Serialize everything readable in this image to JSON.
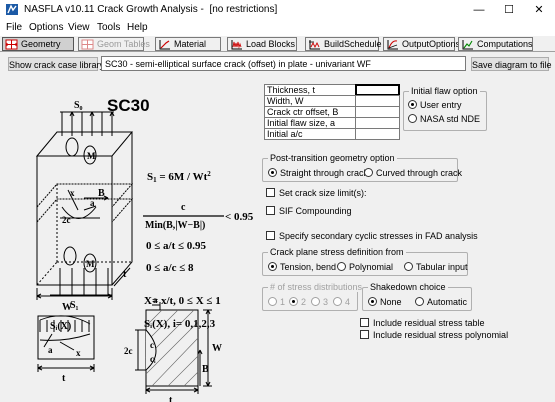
{
  "window": {
    "title": "NASFLA v10.11 Crack Growth Analysis -  [no restrictions]",
    "minimize": "—",
    "maximize": "☐",
    "close": "✕"
  },
  "menu": [
    "File",
    "Options",
    "View",
    "Tools",
    "Help"
  ],
  "tabs": [
    {
      "label": "Geometry",
      "icon": "geometry-icon",
      "state": "active"
    },
    {
      "label": "Geom Tables",
      "icon": "geometry-tables-icon",
      "state": "disabled"
    },
    {
      "label": "Material",
      "icon": "material-chart-icon",
      "state": "normal"
    },
    {
      "label": "Load Blocks",
      "icon": "load-blocks-icon",
      "state": "normal"
    },
    {
      "label": "BuildSchedule",
      "icon": "build-schedule-icon",
      "state": "normal"
    },
    {
      "label": "OutputOptions",
      "icon": "output-options-icon",
      "state": "normal"
    },
    {
      "label": "Computations",
      "icon": "computations-icon",
      "state": "normal"
    }
  ],
  "toolbar": {
    "library_button": "Show crack case library",
    "case_description": "SC30  - semi-elliptical surface crack (offset) in plate - univariant WF",
    "save_button": "Save diagram to file"
  },
  "diagram": {
    "case_code": "SC30",
    "s1_eq": "S",
    "s1_sub": "1",
    "s1_rhs": " = 6M / Wt",
    "s1_sup": "2",
    "frac_num": "c",
    "frac_den": "Min(B,|W−B|)",
    "frac_rhs": "< 0.95",
    "cond1": "0 ≤  a/t  ≤ 0.95",
    "cond2": "0 ≤  a/c  ≤  8",
    "xdef": "X= x/t,  0 ≤ X ≤ 1",
    "sidef": "Sᵢ(X),  i= 0,1,2,3",
    "labels": {
      "s0": "S₀",
      "m": "M",
      "mf": "M",
      "s1": "S₁",
      "w": "W",
      "t": "t",
      "b": "B",
      "x": "x",
      "a": "a",
      "twoc": "2c",
      "si_x": "Sᵢ(X)",
      "x2": "x",
      "a2": "a",
      "t2": "t",
      "a3": "a",
      "w2": "W",
      "b2": "B",
      "c": "c",
      "twoc2": "2c",
      "ci": "cᵢ",
      "t3": "t"
    }
  },
  "params": {
    "rows": [
      {
        "label": "Thickness, t",
        "value": "",
        "focused": true
      },
      {
        "label": "Width, W",
        "value": "",
        "focused": false
      },
      {
        "label": "Crack ctr offset, B",
        "value": "",
        "focused": false
      },
      {
        "label": "Initial flaw size, a",
        "value": "",
        "focused": false
      },
      {
        "label": "Initial a/c",
        "value": "",
        "focused": false
      }
    ]
  },
  "initial_flaw": {
    "title": "Initial flaw option",
    "options": [
      "User entry",
      "NASA std NDE"
    ],
    "selected": 0
  },
  "post_transition": {
    "title": "Post-transition geometry option",
    "options": [
      "Straight through crack",
      "Curved through crack"
    ],
    "selected": 0
  },
  "checkboxes": {
    "crack_size_limits": "Set crack size limit(s):",
    "sif_compounding": "SIF Compounding",
    "secondary_cyclic": "Specify secondary cyclic stresses in FAD analysis",
    "residual_table": "Include residual stress table",
    "residual_poly": "Include residual stress polynomial"
  },
  "crack_plane": {
    "title": "Crack plane stress definition from",
    "options": [
      "Tension, bend",
      "Polynomial",
      "Tabular input"
    ],
    "selected": 0
  },
  "stress_dist": {
    "title": "# of stress distributions",
    "options": [
      "1",
      "2",
      "3",
      "4"
    ],
    "selected": 1
  },
  "shakedown": {
    "title": "Shakedown choice",
    "options": [
      "None",
      "Automatic"
    ],
    "selected": 0
  }
}
